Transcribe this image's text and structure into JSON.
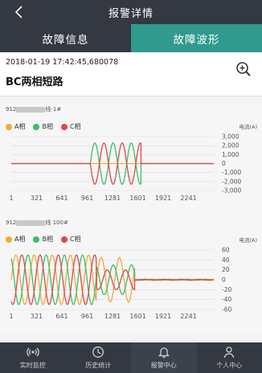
{
  "header": {
    "title": "报警详情"
  },
  "tabs": [
    {
      "label": "故障信息",
      "active": false
    },
    {
      "label": "故障波形",
      "active": true
    }
  ],
  "event": {
    "timestamp": "2018-01-19 17:42:45,680078",
    "fault_type": "BC两相短路"
  },
  "colors": {
    "phase_a": "#f3a93a",
    "phase_b": "#3cbf6a",
    "phase_c": "#e0474c",
    "accent": "#2f9a8d"
  },
  "legend": [
    "A相",
    "B相",
    "C相"
  ],
  "chart_data": [
    {
      "type": "line",
      "title_prefix": "912",
      "title_suffix": "线-1#",
      "unit_label": "电流(A)",
      "xlabels": [
        "1",
        "321",
        "641",
        "961",
        "1281",
        "1601",
        "1921",
        "2241"
      ],
      "xlim": [
        1,
        2560
      ],
      "yticks": [
        "3,000",
        "2,000",
        "1,000",
        "0",
        "-1,000",
        "-2,000",
        "-3,000"
      ],
      "ylim": [
        -3000,
        3000
      ],
      "series": [
        {
          "name": "A相",
          "color": "#f3a93a",
          "segments": [
            {
              "x_start": 1,
              "x_end": 2560,
              "amplitude": 0,
              "period": 230,
              "phase": 0
            }
          ]
        },
        {
          "name": "B相",
          "color": "#3cbf6a",
          "segments": [
            {
              "x_start": 1,
              "x_end": 1000,
              "amplitude": 0,
              "period": 230,
              "phase": 0
            },
            {
              "x_start": 1000,
              "x_end": 1640,
              "amplitude": 2300,
              "period": 230,
              "phase": 0
            },
            {
              "x_start": 1640,
              "x_end": 2560,
              "amplitude": 0,
              "period": 230,
              "phase": 0
            }
          ]
        },
        {
          "name": "C相",
          "color": "#e0474c",
          "segments": [
            {
              "x_start": 1,
              "x_end": 1000,
              "amplitude": 0,
              "period": 230,
              "phase": 0
            },
            {
              "x_start": 1000,
              "x_end": 1640,
              "amplitude": 2300,
              "period": 230,
              "phase": 3.1416
            },
            {
              "x_start": 1640,
              "x_end": 2560,
              "amplitude": 0,
              "period": 230,
              "phase": 0
            }
          ]
        }
      ]
    },
    {
      "type": "line",
      "title_prefix": "912",
      "title_suffix": "线 100#",
      "unit_label": "电流(A)",
      "xlabels": [
        "1",
        "321",
        "641",
        "961",
        "1281",
        "1601",
        "1921",
        "2241"
      ],
      "xlim": [
        1,
        2560
      ],
      "yticks": [
        "60",
        "40",
        "20",
        "0",
        "-20",
        "-40",
        "-60"
      ],
      "ylim": [
        -60,
        60
      ],
      "series": [
        {
          "name": "A相",
          "color": "#f3a93a",
          "segments": [
            {
              "x_start": 1,
              "x_end": 1080,
              "amplitude": 50,
              "period": 230,
              "phase": 0
            },
            {
              "x_start": 1080,
              "x_end": 1560,
              "amplitude": 45,
              "period": 230,
              "phase": 0
            },
            {
              "x_start": 1560,
              "x_end": 2560,
              "amplitude": 1,
              "period": 230,
              "phase": 0
            }
          ]
        },
        {
          "name": "B相",
          "color": "#3cbf6a",
          "segments": [
            {
              "x_start": 1,
              "x_end": 1080,
              "amplitude": 50,
              "period": 230,
              "phase": 2.094
            },
            {
              "x_start": 1080,
              "x_end": 1560,
              "amplitude": 30,
              "period": 230,
              "phase": 2.094
            },
            {
              "x_start": 1560,
              "x_end": 2560,
              "amplitude": 1,
              "period": 230,
              "phase": 2.094
            }
          ]
        },
        {
          "name": "C相",
          "color": "#e0474c",
          "segments": [
            {
              "x_start": 1,
              "x_end": 1080,
              "amplitude": 50,
              "period": 230,
              "phase": 4.189
            },
            {
              "x_start": 1080,
              "x_end": 1560,
              "amplitude": 20,
              "period": 230,
              "phase": 4.189
            },
            {
              "x_start": 1560,
              "x_end": 2560,
              "amplitude": 1,
              "period": 230,
              "phase": 4.189
            }
          ]
        }
      ]
    }
  ],
  "nav": [
    {
      "label": "实时监控",
      "icon": "signal-icon",
      "active": false
    },
    {
      "label": "历史统计",
      "icon": "clock-icon",
      "active": false
    },
    {
      "label": "报警中心",
      "icon": "bell-icon",
      "active": true
    },
    {
      "label": "个人中心",
      "icon": "user-icon",
      "active": false
    }
  ]
}
